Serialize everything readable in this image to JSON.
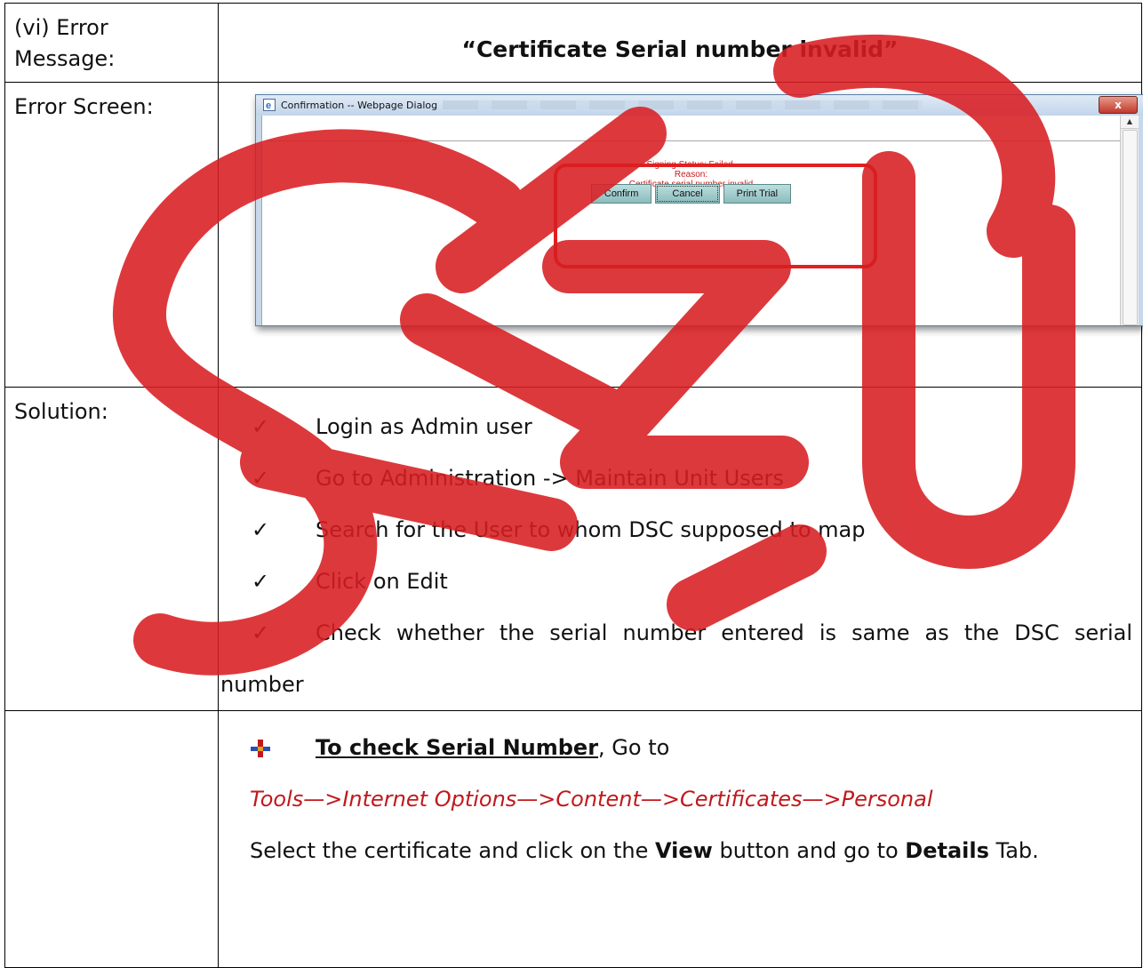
{
  "row1": {
    "label": "(vi) Error Message:",
    "message": "“Certificate Serial number invalid”"
  },
  "row2": {
    "label": "Error Screen:",
    "dialog": {
      "title": "Confirmation -- Webpage Dialog",
      "close_label": "x",
      "status_line1": "Signing Status: Failed.",
      "status_line2": "Reason:",
      "status_line3": "Certificate serial number invalid",
      "buttons": [
        "Confirm",
        "Cancel",
        "Print Trial"
      ]
    }
  },
  "row3": {
    "label": "Solution:",
    "check_glyph": "✓",
    "steps": [
      "Login as Admin user",
      "Go to Administration -> Maintain Unit Users",
      "Search for the User to whom DSC supposed to map",
      "Click on Edit",
      "Check whether the serial number entered is same as the DSC serial"
    ],
    "step_tail": "number"
  },
  "row4": {
    "label": "",
    "lead_bold": "To check Serial Number",
    "lead_rest": ", Go to",
    "path": "Tools—>Internet Options—>Content—>Certificates—>Personal",
    "instruction_pre": "Select the certificate and click on the ",
    "instruction_view": "View",
    "instruction_mid": " button and go to ",
    "instruction_details": "Details",
    "instruction_post": " Tab."
  },
  "colors": {
    "watermark": "#d81e22",
    "path_text": "#c0191d",
    "highlight": "#e02020"
  }
}
